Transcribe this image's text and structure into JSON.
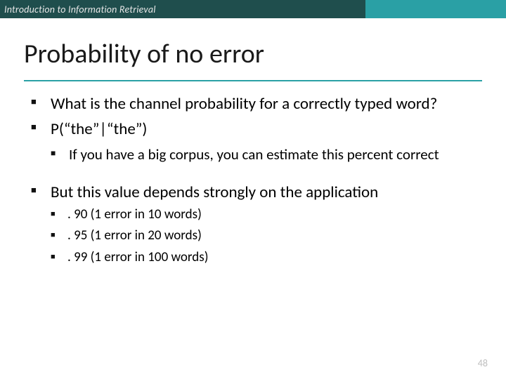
{
  "header": {
    "course": "Introduction to Information Retrieval"
  },
  "title": "Probability of no error",
  "bullets": {
    "b1": "What is the channel probability for a correctly typed word?",
    "b2": "P(“the”|“the”)",
    "b2_sub1": "If you have a big corpus, you can estimate this percent correct",
    "b3": "But this value depends strongly on the application",
    "b3_sub1": ". 90 (1 error in 10 words)",
    "b3_sub2": ". 95 (1 error in 20 words)",
    "b3_sub3": ". 99 (1 error in 100 words)"
  },
  "page_number": "48"
}
